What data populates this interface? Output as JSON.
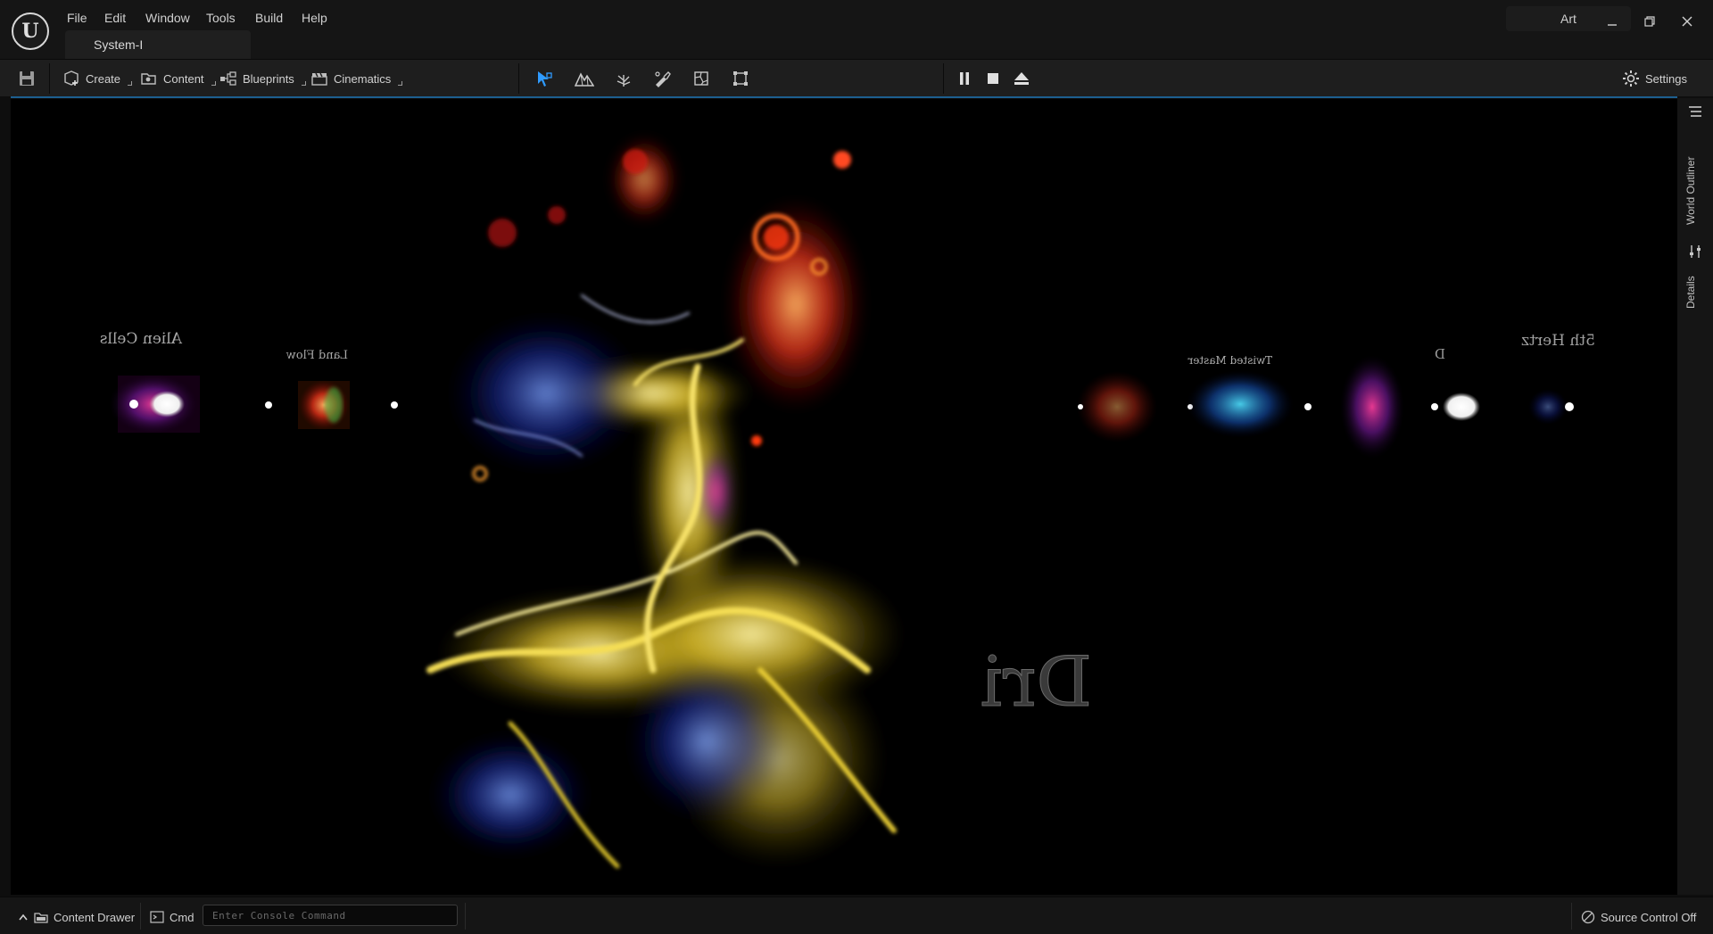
{
  "menu": {
    "items": [
      "File",
      "Edit",
      "Window",
      "Tools",
      "Build",
      "Help"
    ]
  },
  "document_tab": {
    "label": "System-I"
  },
  "project_badge": "Art",
  "window_controls": {
    "minimize": "–",
    "restore": "❐",
    "close": "✕"
  },
  "toolbar": {
    "create_label": "Create",
    "content_label": "Content",
    "blueprints_label": "Blueprints",
    "cinematics_label": "Cinematics",
    "settings_label": "Settings",
    "mode_icons": [
      "select-mode-icon",
      "landscape-mode-icon",
      "foliage-mode-icon",
      "mesh-paint-mode-icon",
      "fracture-mode-icon",
      "modeling-mode-icon"
    ],
    "play_icons": [
      "pause-icon",
      "stop-icon",
      "eject-icon"
    ],
    "accent_color": "#1e90ff"
  },
  "viewport": {
    "labels_left": [
      "Alien Cells",
      "Land Flow"
    ],
    "labels_right": [
      "Twisted Master",
      "5th Hertz",
      "D"
    ],
    "floor_text": "Dri"
  },
  "side_panel": {
    "world_outliner_label": "World Outliner",
    "details_label": "Details"
  },
  "statusbar": {
    "content_drawer_label": "Content Drawer",
    "cmd_label": "Cmd",
    "console_placeholder": "Enter Console Command",
    "source_control_label": "Source Control Off"
  }
}
